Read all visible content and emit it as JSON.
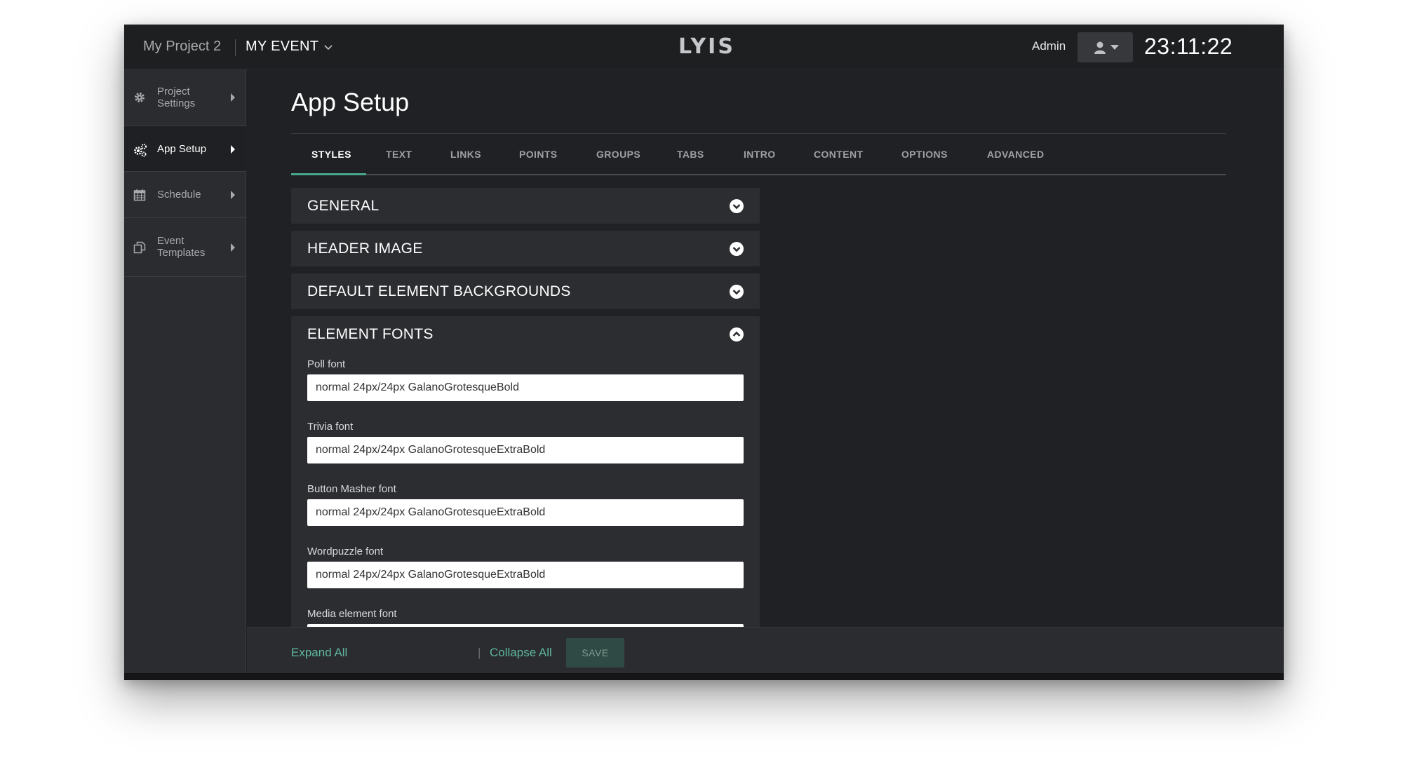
{
  "topbar": {
    "project_name": "My Project 2",
    "event_name": "MY EVENT",
    "logo": "LYIS",
    "admin_label": "Admin",
    "clock": "23:11:22"
  },
  "sidebar": {
    "items": [
      {
        "label": "Project Settings",
        "icon": "gear-icon",
        "active": false
      },
      {
        "label": "App Setup",
        "icon": "gears-icon",
        "active": true
      },
      {
        "label": "Schedule",
        "icon": "calendar-icon",
        "active": false
      },
      {
        "label": "Event Templates",
        "icon": "templates-icon",
        "active": false
      }
    ]
  },
  "main": {
    "title": "App Setup",
    "tabs": [
      {
        "label": "STYLES",
        "active": true
      },
      {
        "label": "TEXT"
      },
      {
        "label": "LINKS"
      },
      {
        "label": "POINTS"
      },
      {
        "label": "GROUPS"
      },
      {
        "label": "TABS"
      },
      {
        "label": "INTRO"
      },
      {
        "label": "CONTENT"
      },
      {
        "label": "OPTIONS"
      },
      {
        "label": "ADVANCED"
      }
    ],
    "sections": [
      {
        "title": "GENERAL",
        "expanded": false
      },
      {
        "title": "HEADER IMAGE",
        "expanded": false
      },
      {
        "title": "DEFAULT ELEMENT BACKGROUNDS",
        "expanded": false
      },
      {
        "title": "ELEMENT FONTS",
        "expanded": true
      }
    ],
    "fonts": [
      {
        "label": "Poll font",
        "value": "normal 24px/24px GalanoGrotesqueBold"
      },
      {
        "label": "Trivia font",
        "value": "normal 24px/24px GalanoGrotesqueExtraBold"
      },
      {
        "label": "Button Masher font",
        "value": "normal 24px/24px GalanoGrotesqueExtraBold"
      },
      {
        "label": "Wordpuzzle font",
        "value": "normal 24px/24px GalanoGrotesqueExtraBold"
      },
      {
        "label": "Media element font",
        "value": ""
      }
    ]
  },
  "footer": {
    "expand_all": "Expand All",
    "separator": "|",
    "collapse_all": "Collapse All",
    "save": "SAVE"
  },
  "colors": {
    "accent": "#4aa58e",
    "link": "#5fb8a0",
    "background": "#202124",
    "panel": "#2c2d31",
    "sidebar": "#2b2c30"
  }
}
